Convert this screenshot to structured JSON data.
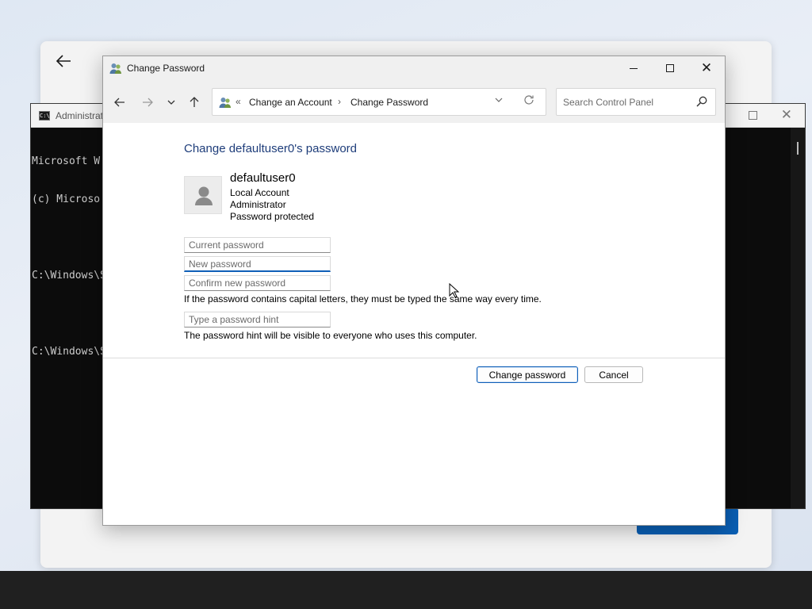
{
  "background_window": {
    "back_icon": "arrow-left-icon"
  },
  "cmd": {
    "title": "Administrat",
    "icon": "terminal-icon",
    "lines": [
      "Microsoft W",
      "(c) Microso",
      "",
      "C:\\Windows\\S",
      "",
      "C:\\Windows\\S"
    ]
  },
  "dialog": {
    "title": "Change Password",
    "controls": {
      "minimize": "minimize-icon",
      "maximize": "maximize-icon",
      "close": "close-icon"
    },
    "nav": {
      "back": "arrow-left-icon",
      "forward": "arrow-right-icon",
      "recent": "chevron-down-icon",
      "up": "arrow-up-icon",
      "breadcrumb_prefix": "«",
      "breadcrumb": [
        "Change an Account",
        "Change Password"
      ],
      "breadcrumb_separator": "›",
      "search_placeholder": "Search Control Panel"
    },
    "heading": "Change defaultuser0's password",
    "account": {
      "name": "defaultuser0",
      "type": "Local Account",
      "role": "Administrator",
      "status": "Password protected"
    },
    "fields": {
      "current_password": "Current password",
      "new_password": "New password",
      "confirm_password": "Confirm new password",
      "hint": "Type a password hint"
    },
    "notes": {
      "capital": "If the password contains capital letters, they must be typed the same way every time.",
      "hint": "The password hint will be visible to everyone who uses this computer."
    },
    "buttons": {
      "change": "Change password",
      "cancel": "Cancel"
    }
  },
  "colors": {
    "heading": "#1e3d7a",
    "focus": "#0f5fb8",
    "taskbar": "#202020"
  }
}
